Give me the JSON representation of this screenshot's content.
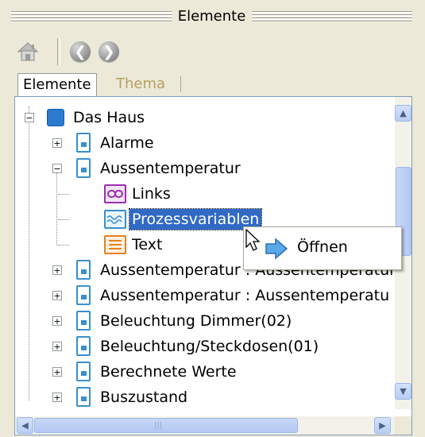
{
  "panel": {
    "title": "Elemente"
  },
  "toolbar": {
    "home_icon": "house-icon",
    "back_icon": "back-arrow-icon",
    "forward_icon": "forward-arrow-icon",
    "back_glyph": "❮",
    "forward_glyph": "❯"
  },
  "tabs": [
    {
      "label": "Elemente",
      "active": true
    },
    {
      "label": "Thema",
      "active": false
    }
  ],
  "tree": {
    "root": {
      "label": "Das Haus",
      "expander": "−"
    },
    "items": [
      {
        "label": "Alarme",
        "expander": "+"
      },
      {
        "label": "Aussentemperatur",
        "expander": "−"
      },
      {
        "label": "Links"
      },
      {
        "label": "Prozessvariablen",
        "selected": true
      },
      {
        "label": "Text"
      },
      {
        "label": "Aussentemperatur : Aussentemperatur",
        "expander": "+"
      },
      {
        "label": "Aussentemperatur : Aussentemperatu",
        "expander": "+"
      },
      {
        "label": "Beleuchtung Dimmer(02)",
        "expander": "+"
      },
      {
        "label": "Beleuchtung/Steckdosen(01)",
        "expander": "+"
      },
      {
        "label": "Berechnete Werte",
        "expander": "+"
      },
      {
        "label": "Buszustand",
        "expander": "+"
      }
    ]
  },
  "scrollbar": {
    "up": "▲",
    "down": "▼",
    "left": "◀",
    "right": "▶",
    "grip": "|||"
  },
  "context_menu": {
    "items": [
      {
        "label": "Öffnen",
        "icon": "open-arrow-icon"
      }
    ]
  },
  "colors": {
    "selection": "#316ac5",
    "accent_blue": "#3a8fd0",
    "links_icon": "#9b2fae",
    "process_icon": "#3a8fd0",
    "text_icon": "#e87f1f",
    "inactive_tab": "#b8a060"
  }
}
